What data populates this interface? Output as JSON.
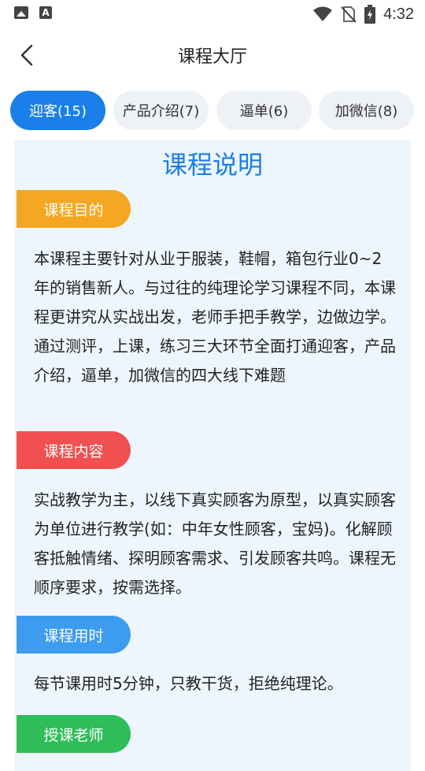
{
  "status_bar": {
    "time": "4:32"
  },
  "header": {
    "title": "课程大厅"
  },
  "tabs": [
    {
      "label": "迎客(15)",
      "active": true
    },
    {
      "label": "产品介绍(7)",
      "active": false
    },
    {
      "label": "逼单(6)",
      "active": false
    },
    {
      "label": "加微信(8)",
      "active": false
    }
  ],
  "card": {
    "title": "课程说明",
    "sections": [
      {
        "label": "课程目的",
        "color": "#f5a623",
        "text": "本课程主要针对从业于服装，鞋帽，箱包行业0~2年的销售新人。与过往的纯理论学习课程不同，本课程更讲究从实战出发，老师手把手教学，边做边学。通过测评，上课，练习三大环节全面打通迎客，产品介绍，逼单，加微信的四大线下难题"
      },
      {
        "label": "课程内容",
        "color": "#f05050",
        "text": "实战教学为主，以线下真实顾客为原型，以真实顾客为单位进行教学(如：中年女性顾客，宝妈)。化解顾客抵触情绪、探明顾客需求、引发顾客共鸣。课程无顺序要求，按需选择。"
      },
      {
        "label": "课程用时",
        "color": "#3d9bf0",
        "text": "每节课用时5分钟，只教干货，拒绝纯理论。"
      },
      {
        "label": "授课老师",
        "color": "#2ebd59"
      }
    ]
  }
}
